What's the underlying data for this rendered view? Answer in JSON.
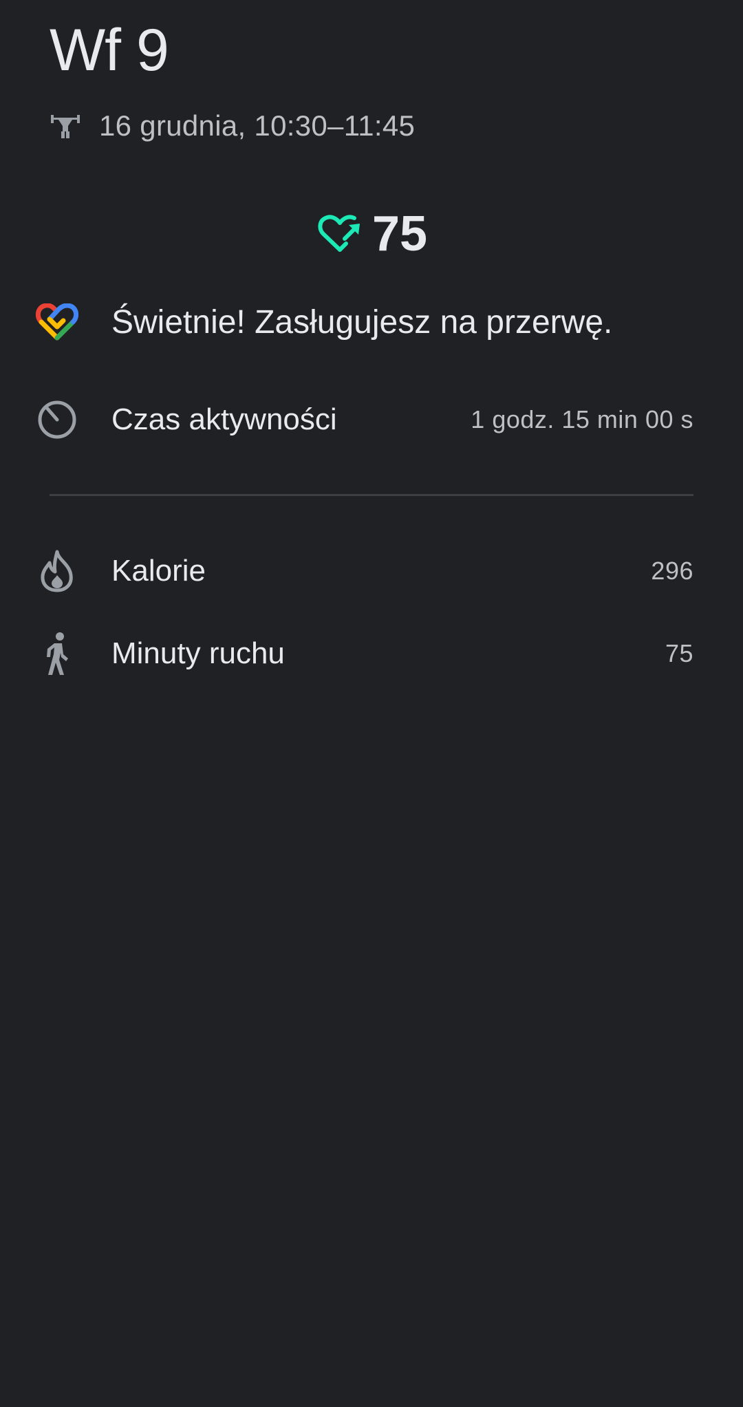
{
  "header": {
    "title": "Wf 9",
    "date_time": "16 grudnia, 10:30–11:45",
    "activity_icon": "weightlifting-icon"
  },
  "heart_points": {
    "value": "75",
    "icon": "heart-points-icon",
    "color": "#1de9b6"
  },
  "message": {
    "text": "Świetnie! Zasługujesz na przerwę.",
    "icon": "google-fit-logo-icon"
  },
  "stats": {
    "active_time": {
      "label": "Czas aktywności",
      "value": "1 godz. 15 min 00 s",
      "icon": "timer-icon"
    },
    "calories": {
      "label": "Kalorie",
      "value": "296",
      "icon": "flame-icon"
    },
    "move_minutes": {
      "label": "Minuty ruchu",
      "value": "75",
      "icon": "walking-person-icon"
    }
  },
  "colors": {
    "background": "#202124",
    "primary_text": "#e8eaed",
    "secondary_text": "#bdc1c6",
    "icon_gray": "#9aa0a6"
  }
}
